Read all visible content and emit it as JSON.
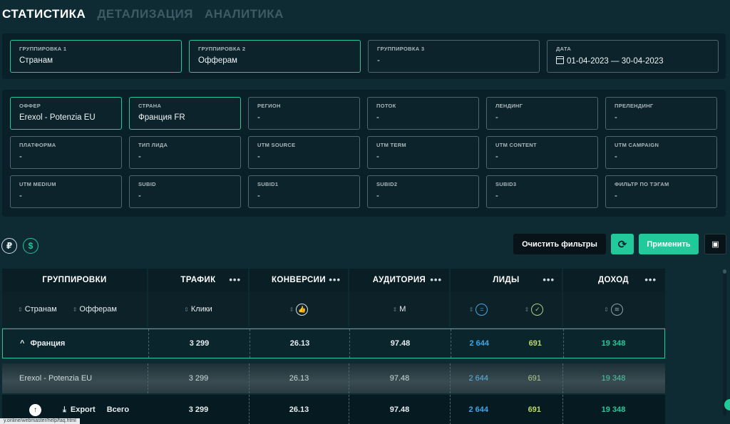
{
  "tabs": [
    "СТАТИСТИКА",
    "ДЕТАЛИЗАЦИЯ",
    "АНАЛИТИКА"
  ],
  "top_fields": [
    {
      "label": "ГРУППИРОВКА 1",
      "value": "Странам"
    },
    {
      "label": "ГРУППИРОВКА 2",
      "value": "Офферам"
    },
    {
      "label": "ГРУППИРОВКА 3",
      "value": "-"
    },
    {
      "label": "ДАТА",
      "value": "01-04-2023 — 30-04-2023"
    }
  ],
  "filters": [
    {
      "label": "ОФФЕР",
      "value": "Erexol - Potenzia EU"
    },
    {
      "label": "СТРАНА",
      "value": "Франция FR"
    },
    {
      "label": "РЕГИОН",
      "value": "-"
    },
    {
      "label": "ПОТОК",
      "value": "-"
    },
    {
      "label": "ЛЕНДИНГ",
      "value": "-"
    },
    {
      "label": "ПРЕЛЕНДИНГ",
      "value": "-"
    },
    {
      "label": "ПЛАТФОРМА",
      "value": "-"
    },
    {
      "label": "ТИП ЛИДА",
      "value": "-"
    },
    {
      "label": "UTM SOURCE",
      "value": "-"
    },
    {
      "label": "UTM TERM",
      "value": "-"
    },
    {
      "label": "UTM CONTENT",
      "value": "-"
    },
    {
      "label": "UTM CAMPAIGN",
      "value": "-"
    },
    {
      "label": "UTM MEDIUM",
      "value": "-"
    },
    {
      "label": "SUBID",
      "value": "-"
    },
    {
      "label": "SUBID1",
      "value": "-"
    },
    {
      "label": "SUBID2",
      "value": "-"
    },
    {
      "label": "SUBID3",
      "value": "-"
    },
    {
      "label": "ФИЛЬТР ПО ТЭГАМ",
      "value": "-"
    }
  ],
  "currency": {
    "rub": "₽",
    "usd": "$"
  },
  "buttons": {
    "clear": "Очистить фильтры",
    "apply": "Применить"
  },
  "table": {
    "headers": [
      "ГРУППИРОВКИ",
      "ТРАФИК",
      "КОНВЕРСИИ",
      "АУДИТОРИЯ",
      "ЛИДЫ",
      "ДОХОД"
    ],
    "sub": {
      "group1": "Странам",
      "group2": "Офферам",
      "traffic": "Клики",
      "audience": "М"
    },
    "rows": [
      {
        "name": "Франция",
        "traffic": "3 299",
        "conv": "26.13",
        "aud": "97.48",
        "leads_a": "2 644",
        "leads_b": "691",
        "income": "19 348"
      },
      {
        "name": "Erexol - Potenzia EU",
        "traffic": "3 299",
        "conv": "26.13",
        "aud": "97.48",
        "leads_a": "2 644",
        "leads_b": "691",
        "income": "19 348"
      }
    ],
    "total": {
      "export": "Export",
      "label": "Всего",
      "traffic": "3 299",
      "conv": "26.13",
      "aud": "97.48",
      "leads_a": "2 644",
      "leads_b": "691",
      "income": "19 348"
    }
  },
  "status_url": "y.online/webmaster/help/faq.html",
  "colors": {
    "accent": "#22c99a",
    "blue": "#3aa8e8",
    "lime": "#b8d86a"
  }
}
